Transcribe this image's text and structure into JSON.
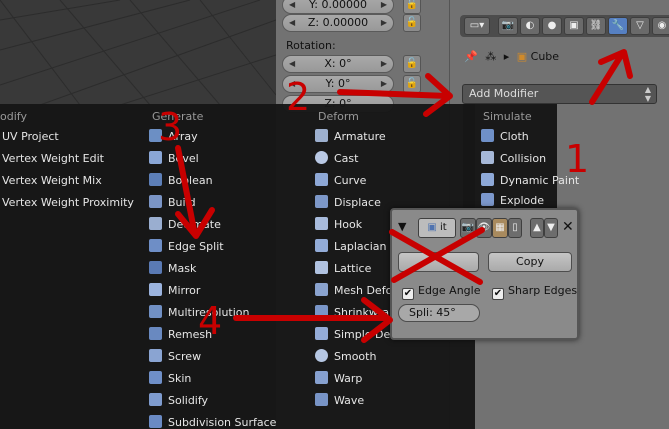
{
  "transform": {
    "location_y": "Y: 0.00000",
    "location_z": "Z: 0.00000",
    "rotation_label": "Rotation:",
    "rotation_x": "X: 0°",
    "rotation_y": "Y: 0°",
    "rotation_z": "Z: 0°"
  },
  "properties": {
    "object_name": "Cube",
    "add_modifier_label": "Add Modifier"
  },
  "menu": {
    "columns": [
      {
        "header": "odify",
        "items": [
          "UV Project",
          "Vertex Weight Edit",
          "Vertex Weight Mix",
          "Vertex Weight Proximity"
        ]
      },
      {
        "header": "Generate",
        "items": [
          "Array",
          "Bevel",
          "Boolean",
          "Build",
          "Decimate",
          "Edge Split",
          "Mask",
          "Mirror",
          "Multiresolution",
          "Remesh",
          "Screw",
          "Skin",
          "Solidify",
          "Subdivision Surface"
        ]
      },
      {
        "header": "Deform",
        "items": [
          "Armature",
          "Cast",
          "Curve",
          "Displace",
          "Hook",
          "Laplacian S",
          "Lattice",
          "Mesh Deform",
          "Shrinkwrap",
          "Simple Deform",
          "Smooth",
          "Warp",
          "Wave"
        ]
      },
      {
        "header": "Simulate",
        "items": [
          "Cloth",
          "Collision",
          "Dynamic Paint",
          "Explode"
        ]
      }
    ]
  },
  "modifier_panel": {
    "name_field": "it",
    "apply_label": "",
    "copy_label": "Copy",
    "edge_angle_label": "Edge Angle",
    "sharp_edges_label": "Sharp Edges",
    "split_angle_label": "Spli: 45°"
  },
  "annotations": {
    "step1": "1",
    "step2": "2",
    "step3": "3",
    "step4": "4"
  },
  "colors": {
    "annotation_red": "#c80000",
    "menu_bg": "#161616",
    "active_tab": "#5680c2"
  }
}
